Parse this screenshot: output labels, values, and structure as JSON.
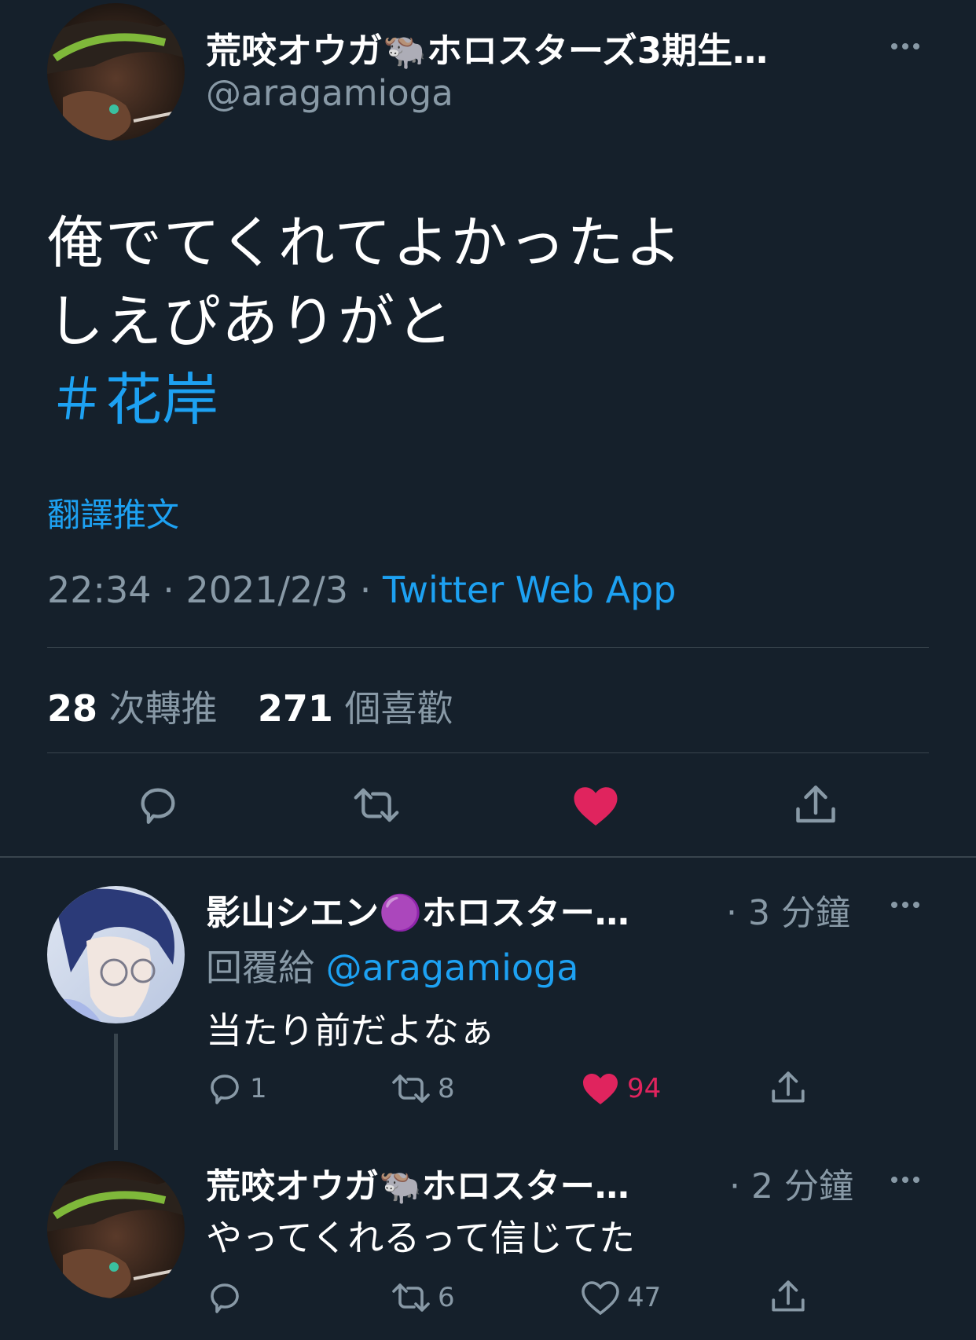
{
  "main_tweet": {
    "display_name": "荒咬オウガ🐃ホロスターズ3期生…",
    "handle": "@aragamioga",
    "text_line1": "俺でてくれてよかったよ",
    "text_line2": "しえぴありがと",
    "hashtag": "＃花岸",
    "translate": "翻譯推文",
    "time": "22:34",
    "date": "2021/2/3",
    "source": "Twitter Web App",
    "retweet_count": "28",
    "retweet_label": "次轉推",
    "like_count": "271",
    "like_label": "個喜歡"
  },
  "replies": [
    {
      "display_name": "影山シエン🟣ホロスター…",
      "time": "· 3 分鐘",
      "reply_to_label": "回覆給",
      "reply_to_handle": "@aragamioga",
      "text": "当たり前だよなぁ",
      "reply_count": "1",
      "retweet_count": "8",
      "like_count": "94",
      "liked": true
    },
    {
      "display_name": "荒咬オウガ🐃ホロスター…",
      "time": "· 2 分鐘",
      "text": "やってくれるって信じてた",
      "reply_count": "",
      "retweet_count": "6",
      "like_count": "47",
      "liked": false
    }
  ],
  "colors": {
    "background": "#15202b",
    "link": "#1da1f2",
    "muted": "#8899a6",
    "like": "#e0245e",
    "divider": "#38444d"
  }
}
